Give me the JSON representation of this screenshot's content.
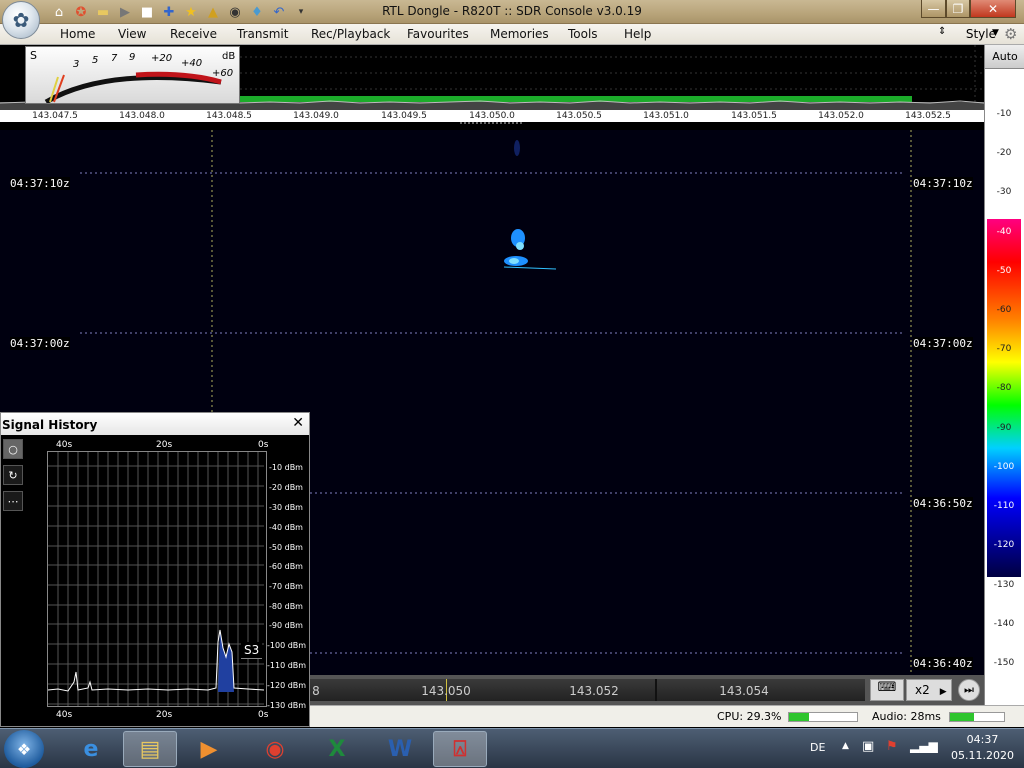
{
  "window": {
    "title": "RTL Dongle - R820T :: SDR Console v3.0.19"
  },
  "menu": {
    "items": [
      "Home",
      "View",
      "Receive",
      "Transmit",
      "Rec/Playback",
      "Favourites",
      "Memories",
      "Tools",
      "Help"
    ],
    "style_label": "Style"
  },
  "smeter": {
    "s_label": "S",
    "db_label": "dB",
    "scale": [
      "3",
      "5",
      "7",
      "9",
      "+20",
      "+40",
      "+60"
    ]
  },
  "frequency_scale": [
    "143.047.5",
    "143.048.0",
    "143.048.5",
    "143.049.0",
    "143.049.5",
    "143.050.0",
    "143.050.5",
    "143.051.0",
    "143.051.5",
    "143.052.0",
    "143.052.5"
  ],
  "right_panel": {
    "auto_label": "Auto",
    "db_ticks": [
      "-10",
      "-20",
      "-30",
      "-40",
      "-50",
      "-60",
      "-70",
      "-80",
      "-90",
      "-100",
      "-110",
      "-120",
      "-130",
      "-140",
      "-150"
    ]
  },
  "waterfall": {
    "time_labels": [
      "04:37:10z",
      "04:37:00z",
      "04:36:50z",
      "04:36:40z"
    ]
  },
  "signal_history": {
    "title": "Signal History",
    "top_time_labels": [
      "40s",
      "20s",
      "0s"
    ],
    "bottom_time_labels": [
      "40s",
      "20s",
      "0s"
    ],
    "dbm_labels": [
      "-10 dBm",
      "-20 dBm",
      "-30 dBm",
      "-40 dBm",
      "-50 dBm",
      "-60 dBm",
      "-70 dBm",
      "-80 dBm",
      "-90 dBm",
      "-100 dBm",
      "-110 dBm",
      "-120 dBm",
      "-130 dBm"
    ],
    "s_reading": "S3"
  },
  "bottom_freq": {
    "labels": [
      "8",
      "143.050",
      "143.052",
      "143.054"
    ],
    "zoom": "x2"
  },
  "status": {
    "cpu": "CPU: 29.3%",
    "audio": "Audio: 28ms"
  },
  "taskbar": {
    "lang": "DE",
    "time": "04:37",
    "date": "05.11.2020"
  }
}
